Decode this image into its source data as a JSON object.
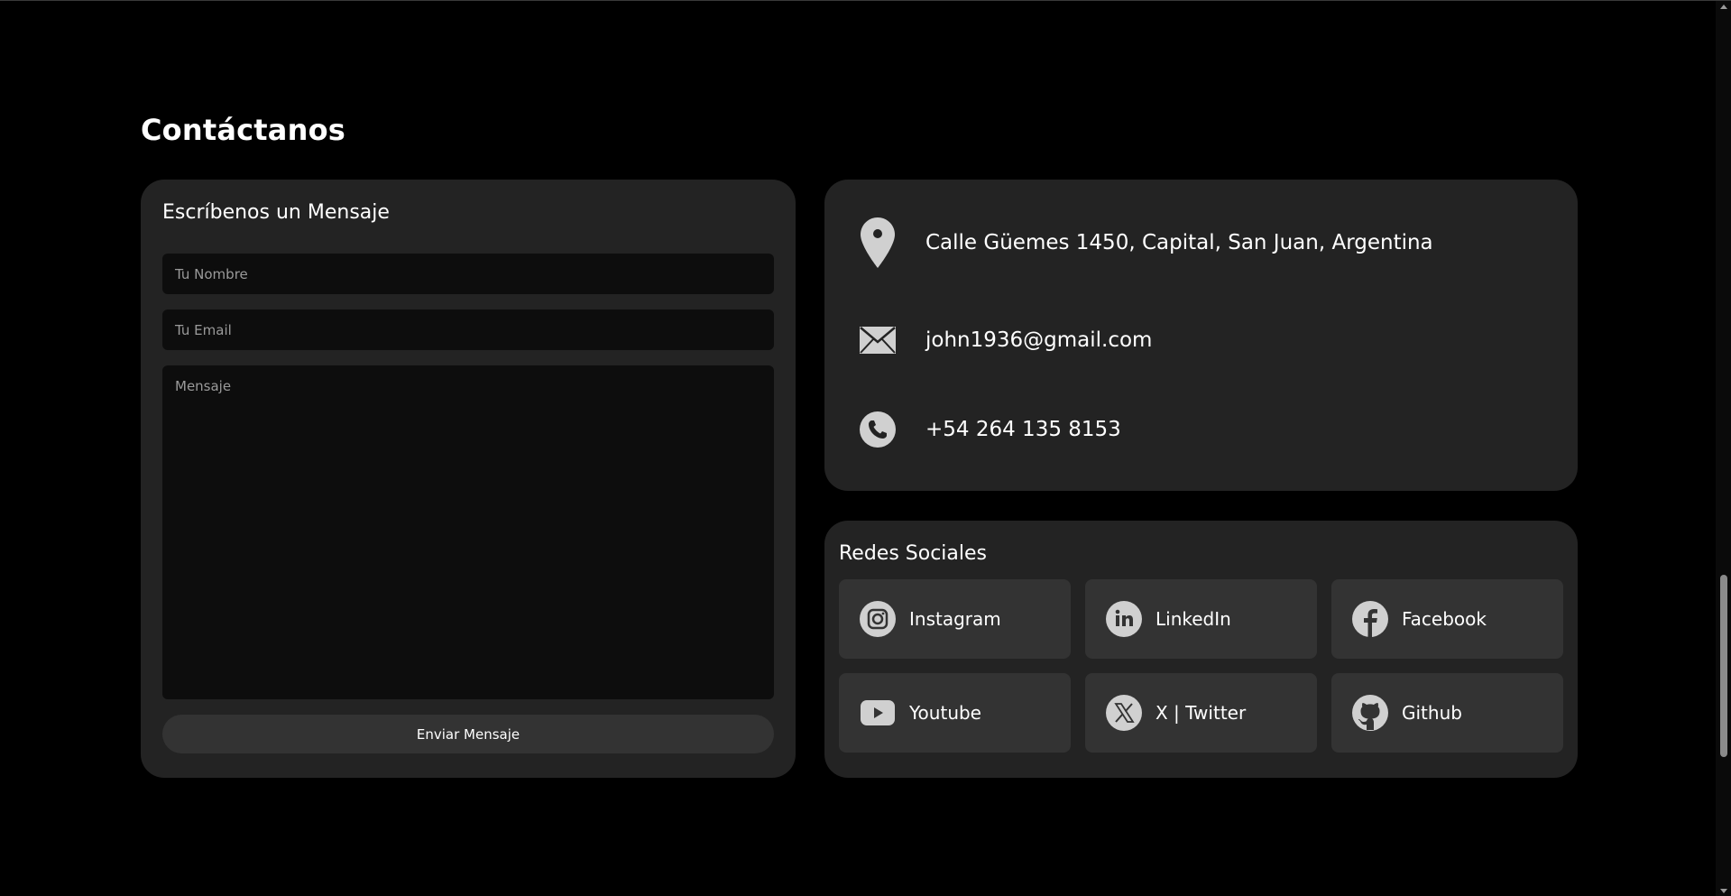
{
  "section": {
    "title": "Contáctanos"
  },
  "form": {
    "title": "Escríbenos un Mensaje",
    "name_placeholder": "Tu Nombre",
    "email_placeholder": "Tu Email",
    "message_placeholder": "Mensaje",
    "submit_label": "Enviar Mensaje"
  },
  "contact_info": {
    "address": "Calle Güemes 1450, Capital, San Juan, Argentina",
    "email": "john1936@gmail.com",
    "phone": "+54 264 135 8153",
    "icons": [
      "location-pin-icon",
      "envelope-icon",
      "phone-icon"
    ]
  },
  "social": {
    "title": "Redes Sociales",
    "items": [
      {
        "label": "Instagram",
        "icon": "instagram-icon"
      },
      {
        "label": "LinkedIn",
        "icon": "linkedin-icon"
      },
      {
        "label": "Facebook",
        "icon": "facebook-icon"
      },
      {
        "label": "Youtube",
        "icon": "youtube-icon"
      },
      {
        "label": "X | Twitter",
        "icon": "x-twitter-icon"
      },
      {
        "label": "Github",
        "icon": "github-icon"
      }
    ]
  },
  "colors": {
    "background": "#000000",
    "card": "#232323",
    "tile": "#333333",
    "input": "#0d0d0d",
    "icon": "#d0d0d0",
    "text": "#ffffff",
    "placeholder": "#9a9a9a"
  }
}
